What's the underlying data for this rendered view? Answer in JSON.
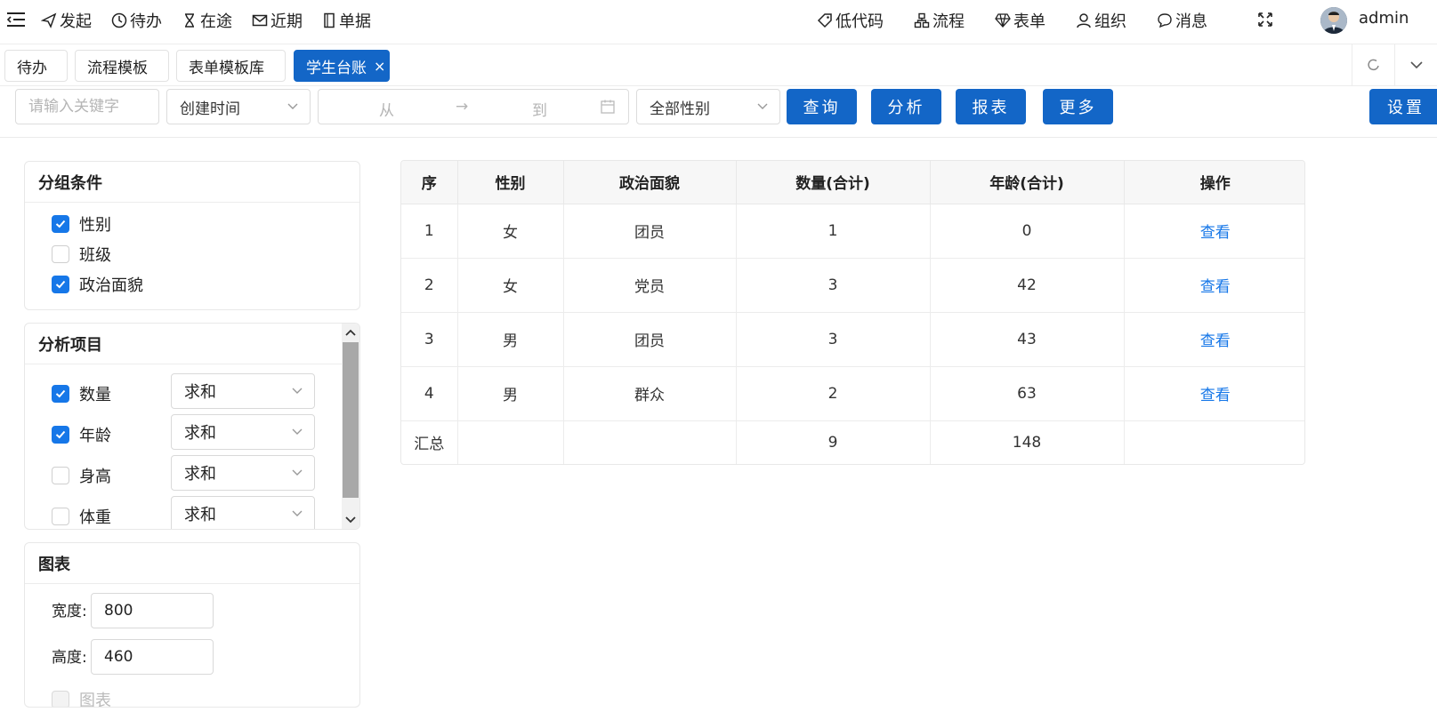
{
  "topnav": {
    "left": [
      {
        "label": "发起",
        "icon": "send-icon"
      },
      {
        "label": "待办",
        "icon": "clock-icon"
      },
      {
        "label": "在途",
        "icon": "hourglass-icon"
      },
      {
        "label": "近期",
        "icon": "mail-icon"
      },
      {
        "label": "单据",
        "icon": "document-icon"
      }
    ],
    "right": [
      {
        "label": "低代码",
        "icon": "tag-icon"
      },
      {
        "label": "流程",
        "icon": "flow-icon"
      },
      {
        "label": "表单",
        "icon": "diamond-icon"
      },
      {
        "label": "组织",
        "icon": "user-icon"
      },
      {
        "label": "消息",
        "icon": "chat-icon"
      }
    ],
    "username": "admin"
  },
  "tabs": [
    {
      "label": "待办"
    },
    {
      "label": "流程模板"
    },
    {
      "label": "表单模板库"
    },
    {
      "label": "学生台账",
      "active": true,
      "close": "×"
    }
  ],
  "toolbar": {
    "keyword_placeholder": "请输入关键字",
    "time_field": "创建时间",
    "date_from": "从",
    "date_arrow": "→",
    "date_to": "到",
    "gender_filter": "全部性别",
    "query": "查询",
    "analyze": "分析",
    "report": "报表",
    "more": "更多",
    "settings": "设置"
  },
  "group_panel": {
    "title": "分组条件",
    "items": [
      {
        "label": "性别",
        "checked": true
      },
      {
        "label": "班级",
        "checked": false
      },
      {
        "label": "政治面貌",
        "checked": true
      }
    ]
  },
  "analysis_panel": {
    "title": "分析项目",
    "items": [
      {
        "label": "数量",
        "checked": true,
        "agg": "求和"
      },
      {
        "label": "年龄",
        "checked": true,
        "agg": "求和"
      },
      {
        "label": "身高",
        "checked": false,
        "agg": "求和"
      },
      {
        "label": "体重",
        "checked": false,
        "agg": "求和"
      }
    ]
  },
  "chart_panel": {
    "title": "图表",
    "width_label": "宽度:",
    "width_value": "800",
    "height_label": "高度:",
    "height_value": "460",
    "chart_label": "图表"
  },
  "table": {
    "headers": [
      "序",
      "性别",
      "政治面貌",
      "数量(合计)",
      "年龄(合计)",
      "操作"
    ],
    "rows": [
      [
        "1",
        "女",
        "团员",
        "1",
        "0",
        "查看"
      ],
      [
        "2",
        "女",
        "党员",
        "3",
        "42",
        "查看"
      ],
      [
        "3",
        "男",
        "团员",
        "3",
        "43",
        "查看"
      ],
      [
        "4",
        "男",
        "群众",
        "2",
        "63",
        "查看"
      ]
    ],
    "summary": [
      "汇总",
      "",
      "",
      "9",
      "148",
      ""
    ]
  },
  "colors": {
    "primary": "#1366c7",
    "checkbox": "#1677e8",
    "link": "#1677e8"
  }
}
